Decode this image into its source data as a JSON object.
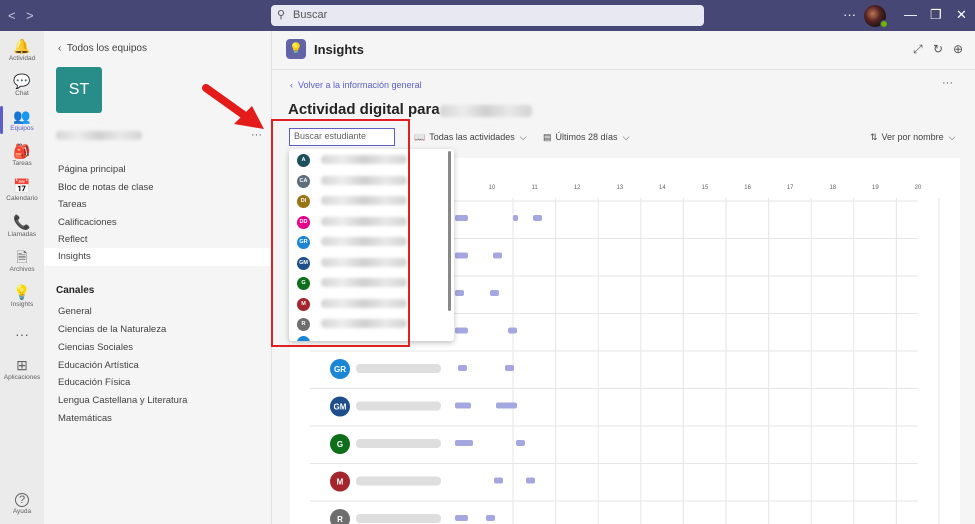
{
  "titlebar": {
    "back": "<",
    "forward": ">",
    "search_placeholder": "Buscar",
    "more": "···",
    "minimize": "—",
    "maximize": "❐",
    "close": "✕"
  },
  "rail": [
    {
      "label": "Actividad",
      "icon": "bell-icon",
      "glyph": "🔔"
    },
    {
      "label": "Chat",
      "icon": "chat-icon",
      "glyph": "💬"
    },
    {
      "label": "Equipos",
      "icon": "teams-icon",
      "glyph": "👥"
    },
    {
      "label": "Tareas",
      "icon": "assignments-icon",
      "glyph": "🎒"
    },
    {
      "label": "Calendario",
      "icon": "calendar-icon",
      "glyph": "📅"
    },
    {
      "label": "Llamadas",
      "icon": "phone-icon",
      "glyph": "📞"
    },
    {
      "label": "Archivos",
      "icon": "file-icon",
      "glyph": "🗎"
    },
    {
      "label": "Insights",
      "icon": "insights-icon",
      "glyph": "💡"
    },
    {
      "label": "···",
      "icon": "more-icon",
      "glyph": ""
    },
    {
      "label": "Aplicaciones",
      "icon": "apps-icon",
      "glyph": "⊞"
    },
    {
      "label": "Ayuda",
      "icon": "help-icon",
      "glyph": "?"
    }
  ],
  "team": {
    "back_label": "Todos los equipos",
    "initials": "ST",
    "more": "···",
    "nav": [
      "Página principal",
      "Bloc de notas de clase",
      "Tareas",
      "Calificaciones",
      "Reflect",
      "Insights"
    ],
    "channels_heading": "Canales",
    "channels": [
      "General",
      "Ciencias de la Naturaleza",
      "Ciencias Sociales",
      "Educación Artística",
      "Educación Física",
      "Lengua Castellana y Literatura",
      "Matemáticas"
    ]
  },
  "main": {
    "app_title": "Insights",
    "back_link": "Volver a la información general",
    "more": "···",
    "heading": "Actividad digital para",
    "search_student_placeholder": "Buscar estudiante",
    "filter_activities": "Todas las actividades",
    "filter_period": "Últimos 28 días",
    "sort": "Ver por nombre"
  },
  "dropdown_students": [
    {
      "initials": "A",
      "color": "#1b4f5c"
    },
    {
      "initials": "CA",
      "color": "#5b6e7a"
    },
    {
      "initials": "DI",
      "color": "#9a7412"
    },
    {
      "initials": "DD",
      "color": "#e3008c"
    },
    {
      "initials": "GR",
      "color": "#1a86d4"
    },
    {
      "initials": "GM",
      "color": "#1e4f8a"
    },
    {
      "initials": "G",
      "color": "#0f6e1a"
    },
    {
      "initials": "M",
      "color": "#a4262c"
    },
    {
      "initials": "R",
      "color": "#6e6e6e"
    }
  ],
  "chart_data": {
    "type": "scatter",
    "x_ticks": [
      "10",
      "11",
      "12",
      "13",
      "14",
      "15",
      "16",
      "17",
      "18",
      "19",
      "20"
    ],
    "rows": [
      {
        "initials": "",
        "color": "#ffffff"
      },
      {
        "initials": "",
        "color": "#ffffff"
      },
      {
        "initials": "",
        "color": "#ffffff"
      },
      {
        "initials": "",
        "color": "#ffffff"
      },
      {
        "initials": "GR",
        "color": "#1a86d4"
      },
      {
        "initials": "GM",
        "color": "#1e4f8a"
      },
      {
        "initials": "G",
        "color": "#0f6e1a"
      },
      {
        "initials": "M",
        "color": "#a4262c"
      },
      {
        "initials": "R",
        "color": "#6e6e6e"
      }
    ],
    "bar_color": "#a5a7e0"
  }
}
